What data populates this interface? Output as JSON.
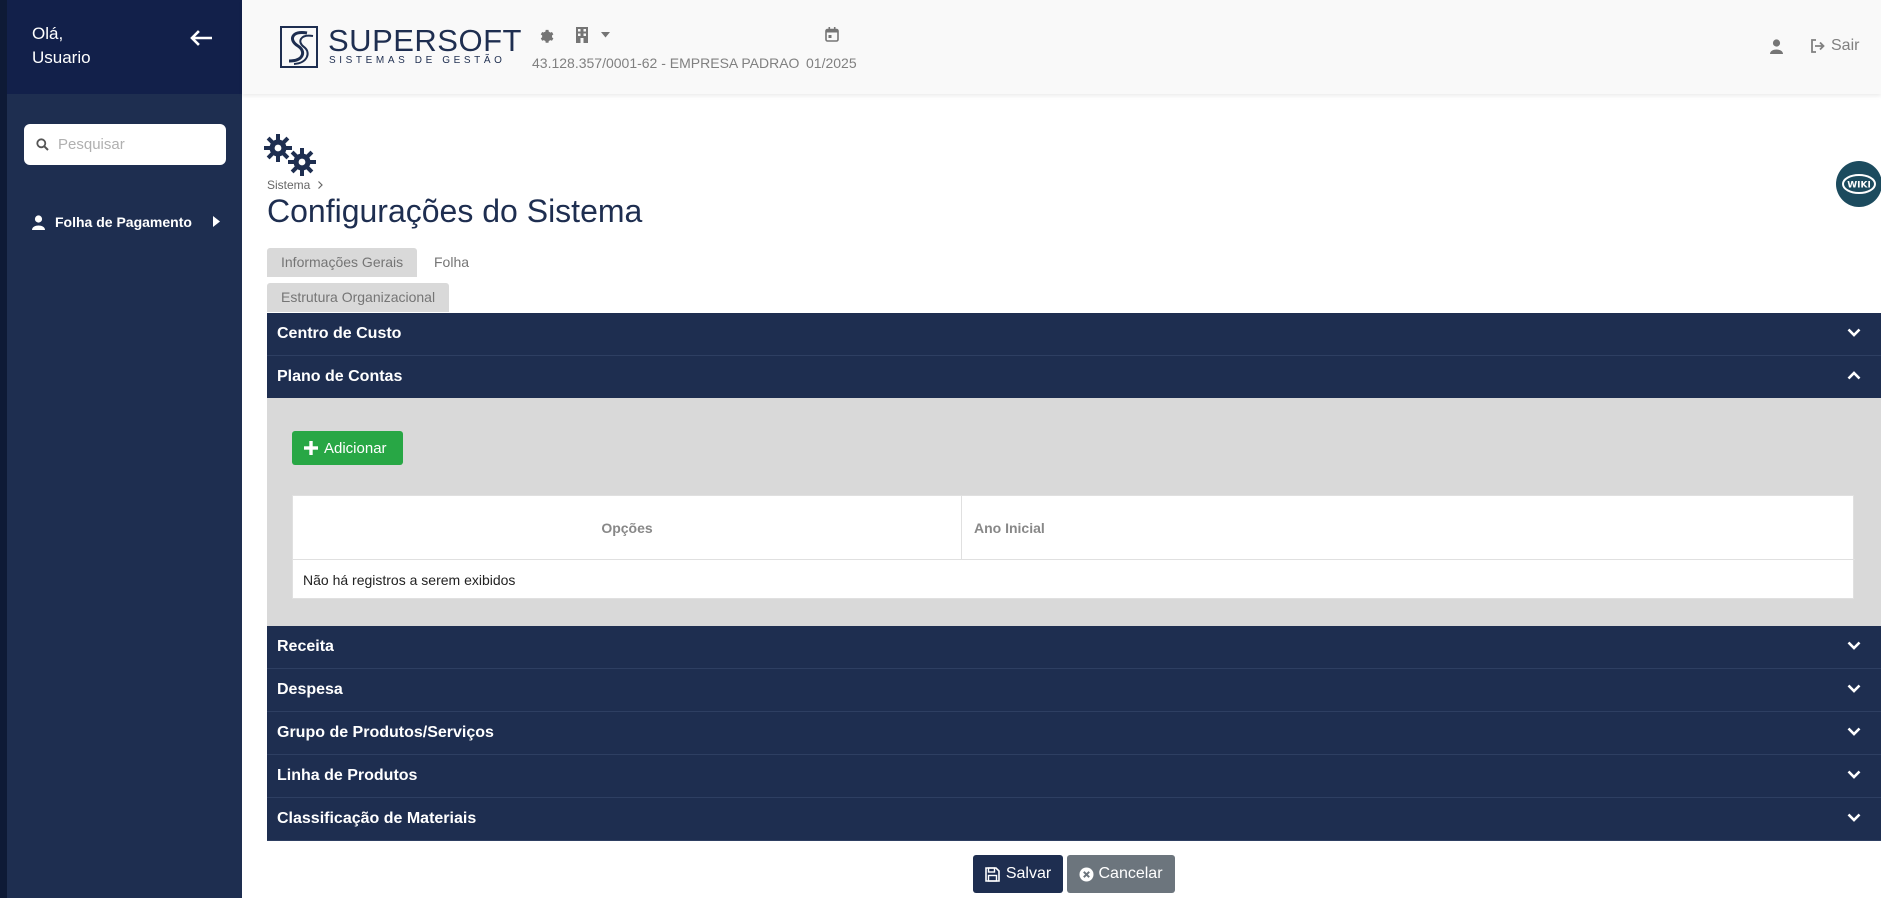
{
  "colors": {
    "primary": "#1e2e50",
    "success": "#28a745",
    "secondary": "#6c757d",
    "panel": "#d9d9d9",
    "wiki": "#1c4b5e"
  },
  "sidebar": {
    "greeting_line1": "Olá,",
    "greeting_line2": "Usuario",
    "back_icon": "arrow-left-icon",
    "search_placeholder": "Pesquisar",
    "search_value": "",
    "items": [
      {
        "label": "Folha de Pagamento",
        "icon": "user-icon"
      }
    ]
  },
  "header": {
    "brand_name": "SUPERSOFT",
    "brand_tagline": "SISTEMAS DE GESTÃO",
    "company": "43.128.357/0001-62 - EMPRESA PADRAO",
    "period": "01/2025",
    "logout_label": "Sair"
  },
  "main": {
    "breadcrumb": "Sistema",
    "title": "Configurações do Sistema",
    "wiki_label": "WIKI",
    "tabs": [
      {
        "label": "Informações Gerais",
        "active": true
      },
      {
        "label": "Folha",
        "active": false
      },
      {
        "label": "Estrutura Organizacional",
        "active": false
      }
    ],
    "accordions": [
      {
        "label": "Centro de Custo",
        "expanded": false
      },
      {
        "label": "Plano de Contas",
        "expanded": true
      },
      {
        "label": "Receita",
        "expanded": false
      },
      {
        "label": "Despesa",
        "expanded": false
      },
      {
        "label": "Grupo de Produtos/Serviços",
        "expanded": false
      },
      {
        "label": "Linha de Produtos",
        "expanded": false
      },
      {
        "label": "Classificação de Materiais",
        "expanded": false
      }
    ],
    "plano": {
      "add_label": "Adicionar",
      "columns": [
        "Opções",
        "Ano Inicial"
      ],
      "empty_message": "Não há registros a serem exibidos"
    },
    "save_label": "Salvar",
    "cancel_label": "Cancelar"
  }
}
